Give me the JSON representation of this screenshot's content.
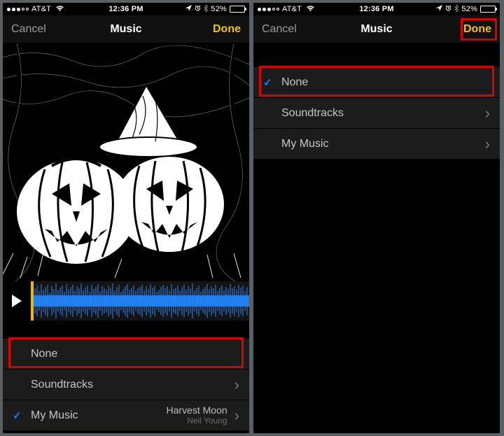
{
  "status": {
    "carrier": "AT&T",
    "time": "12:36 PM",
    "battery_pct": "52%"
  },
  "nav": {
    "cancel": "Cancel",
    "title": "Music",
    "done": "Done"
  },
  "left": {
    "rows": {
      "none": {
        "label": "None",
        "selected": false
      },
      "soundtracks": {
        "label": "Soundtracks",
        "has_chevron": true
      },
      "mymusic": {
        "label": "My Music",
        "selected": true,
        "has_chevron": true,
        "track_title": "Harvest Moon",
        "track_artist": "Neil Young"
      }
    }
  },
  "right": {
    "rows": {
      "none": {
        "label": "None",
        "selected": true
      },
      "soundtracks": {
        "label": "Soundtracks",
        "has_chevron": true
      },
      "mymusic": {
        "label": "My Music",
        "has_chevron": true
      }
    }
  }
}
